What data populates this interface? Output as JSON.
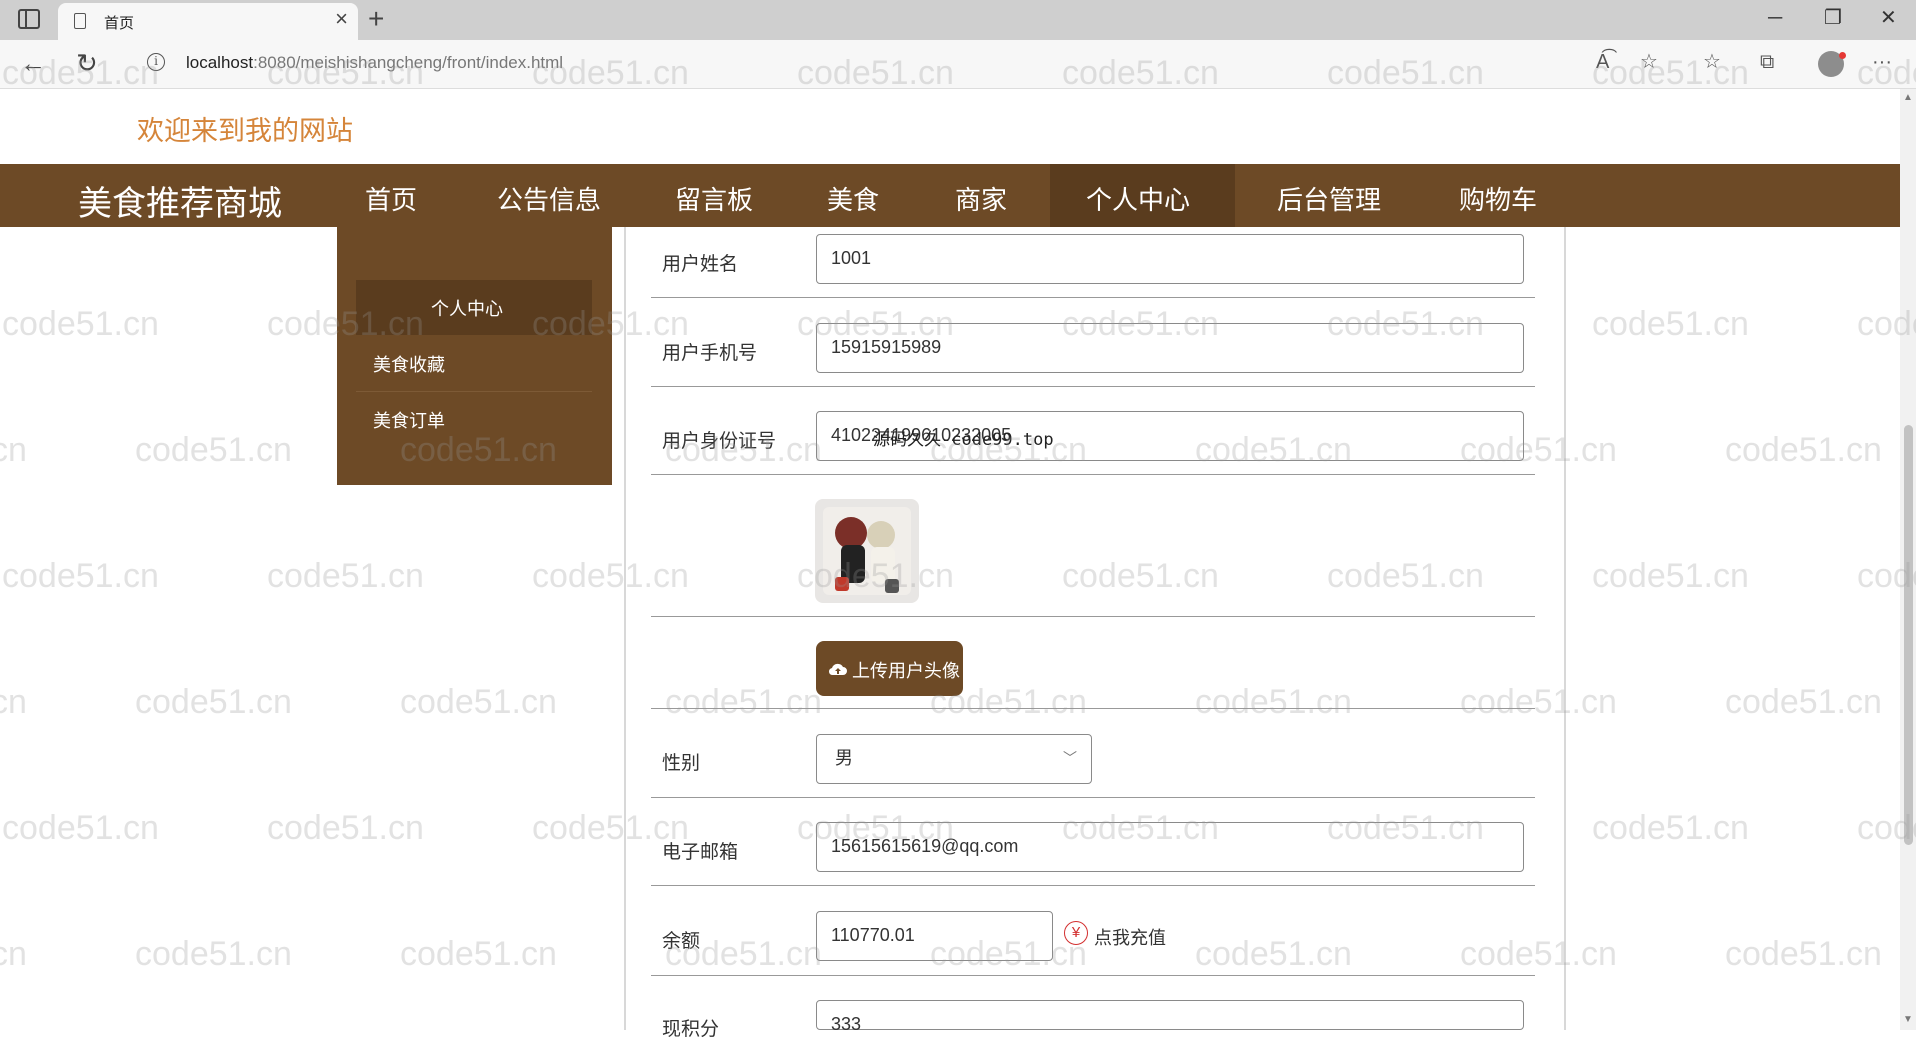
{
  "browser": {
    "tab_title": "首页",
    "url_host": "localhost",
    "url_rest": ":8080/meishishangcheng/front/index.html",
    "icons": [
      "sidebar-toggle-icon",
      "page-icon",
      "close-icon",
      "plus-icon",
      "back-icon",
      "refresh-icon",
      "info-icon",
      "read-aloud-icon",
      "favorite-icon",
      "favorites-list-icon",
      "collections-icon",
      "profile-icon",
      "more-icon"
    ]
  },
  "header": {
    "welcome": "欢迎来到我的网站"
  },
  "navbar": {
    "brand": "美食推荐商城",
    "items": [
      "首页",
      "公告信息",
      "留言板",
      "美食",
      "商家",
      "个人中心",
      "后台管理",
      "购物车"
    ],
    "active": "个人中心",
    "color": "#6d4a26"
  },
  "side_menu": {
    "items": [
      "个人中心",
      "美食收藏",
      "美食订单"
    ]
  },
  "form": {
    "name_label": "用户姓名",
    "name_value": "1001",
    "phone_label": "用户手机号",
    "phone_value": "15915915989",
    "id_label": "用户身份证号",
    "id_value": "410224199610232005",
    "avatar_caption": "源码久久-code99.top",
    "upload_label": "上传用户头像",
    "gender_label": "性别",
    "gender_value": "男",
    "email_label": "电子邮箱",
    "email_value": "15615615619@qq.com",
    "balance_label": "余额",
    "balance_value": "110770.01",
    "recharge_label": "点我充值",
    "points_label": "现积分",
    "points_value": "333"
  },
  "watermark": "code51.cn"
}
